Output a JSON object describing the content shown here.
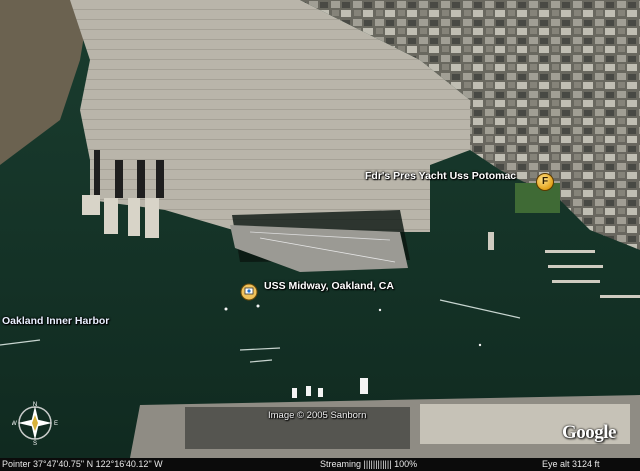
{
  "map": {
    "placemarks": [
      {
        "id": "potomac",
        "label": "Fdr's Pres Yacht Uss Potomac",
        "icon": "letter-f-marker-icon",
        "icon_letter": "F"
      },
      {
        "id": "midway",
        "label": "USS Midway, Oakland, CA",
        "icon": "placemark-pin-icon"
      }
    ],
    "area_label": "Oakland Inner Harbor",
    "copyright": "Image © 2005 Sanborn",
    "logo": "Google",
    "compass": {
      "north": "N",
      "south": "S",
      "east": "E",
      "west": "W"
    }
  },
  "status_bar": {
    "pointer": "Pointer  37°47'40.75\" N  122°16'40.12\" W",
    "streaming": "Streaming |||||||||||| 100%",
    "eye_alt": "Eye  alt    3124 ft"
  },
  "colors": {
    "water": "#16382b",
    "pier_concrete": "#b5b1a6",
    "status_bar_bg": "#0b0b0b",
    "marker_gold": "#e3a21a"
  }
}
